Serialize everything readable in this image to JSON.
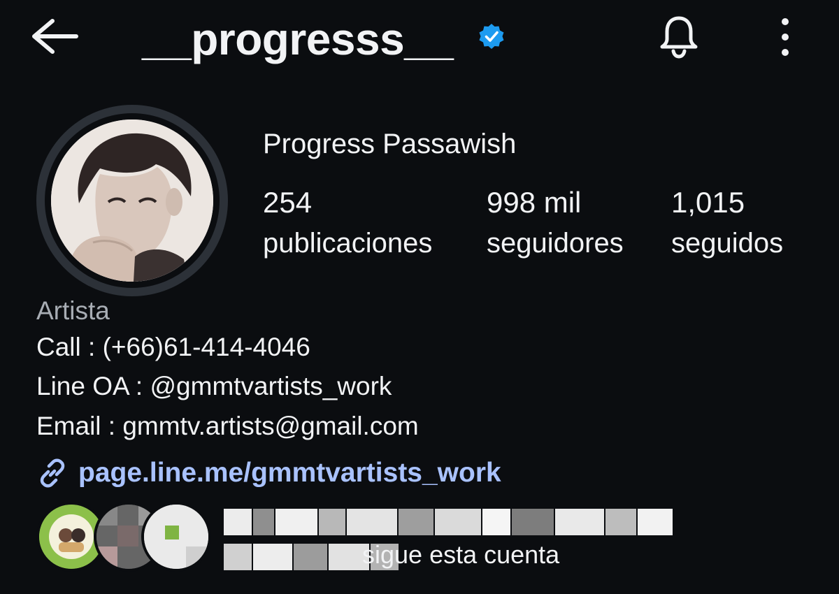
{
  "header": {
    "username": "__progresss__",
    "back_icon": "arrow-left-icon",
    "verified_icon": "verified-badge-icon",
    "notifications_icon": "bell-icon",
    "menu_icon": "more-vertical-icon",
    "verified_color": "#1d9bf0"
  },
  "profile": {
    "full_name": "Progress Passawish",
    "stats": {
      "posts_count": "254",
      "posts_label": "publicaciones",
      "followers_count": "998 mil",
      "followers_label": "seguidores",
      "following_count": "1,015",
      "following_label": "seguidos"
    },
    "category": "Artista",
    "bio_lines": [
      "Call : (+66)61-414-4046",
      "Line OA : @gmmtvartists_work",
      "Email : gmmtv.artists@gmail.com"
    ],
    "link_icon": "link-icon",
    "link": "page.line.me/gmmtvartists_work",
    "link_color": "#a9c2ff"
  },
  "followed_by": {
    "text_visible_suffix": "sigue esta cuenta"
  }
}
